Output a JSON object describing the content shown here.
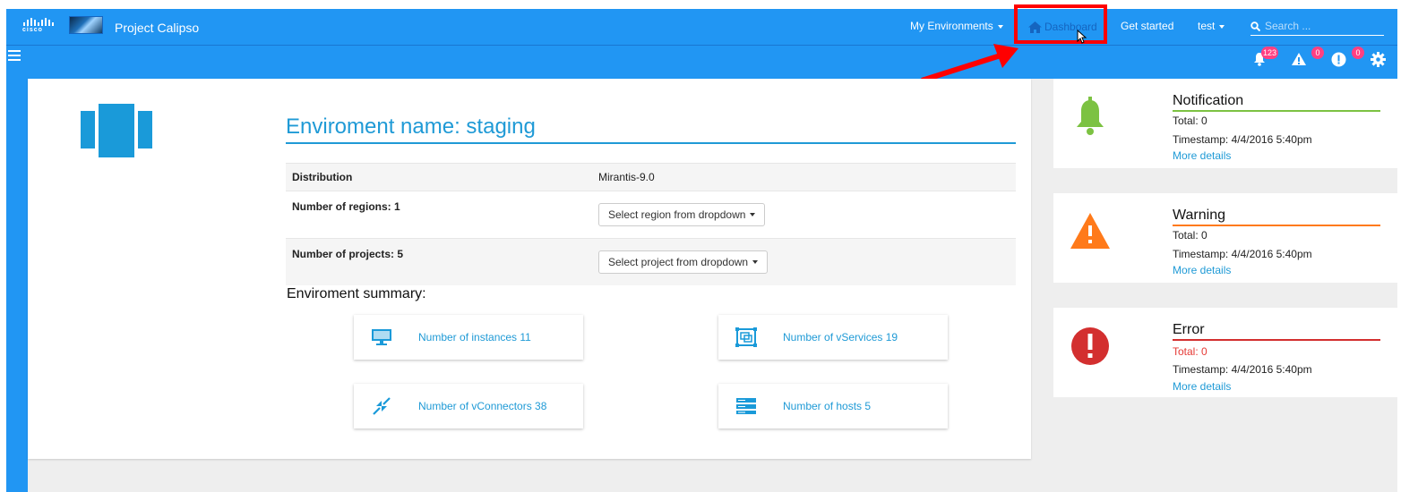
{
  "brand": {
    "logo_text": "cisco",
    "app_title": "Project Calipso"
  },
  "nav": {
    "environments": "My Environments",
    "dashboard": "Dashboard",
    "get_started": "Get started",
    "user": "test",
    "search_placeholder": "Search ..."
  },
  "status_badges": {
    "notifications": "123",
    "warnings": "0",
    "errors": "0"
  },
  "environment": {
    "title": "Enviroment name: staging",
    "rows": [
      {
        "label": "Distribution",
        "value": "Mirantis-9.0"
      },
      {
        "label": "Number of regions: 1",
        "dropdown": "Select region from dropdown"
      },
      {
        "label": "Number of projects: 5",
        "dropdown": "Select project from dropdown"
      }
    ]
  },
  "summary": {
    "title": "Enviroment summary:",
    "cards": [
      {
        "icon": "monitor-icon",
        "label": "Number of instances 11"
      },
      {
        "icon": "vservice-icon",
        "label": "Number of vServices 19"
      },
      {
        "icon": "vconnector-icon",
        "label": "Number of vConnectors 38"
      },
      {
        "icon": "hosts-icon",
        "label": "Number of hosts 5"
      }
    ]
  },
  "alerts": [
    {
      "title": "Notification",
      "total": "Total: 0",
      "timestamp": "Timestamp: 4/4/2016 5:40pm",
      "link": "More details",
      "color": "#8bc34a"
    },
    {
      "title": "Warning",
      "total": "Total: 0",
      "timestamp": "Timestamp: 4/4/2016 5:40pm",
      "link": "More details",
      "color": "#ff6f00"
    },
    {
      "title": "Error",
      "total": "Total: 0",
      "timestamp": "Timestamp: 4/4/2016 5:40pm",
      "link": "More details",
      "color": "#d32f2f"
    }
  ],
  "colors": {
    "topbar": "#2196f3",
    "accent": "#1f9ad6",
    "highlight": "#ff0000",
    "badge": "#ff4081"
  }
}
